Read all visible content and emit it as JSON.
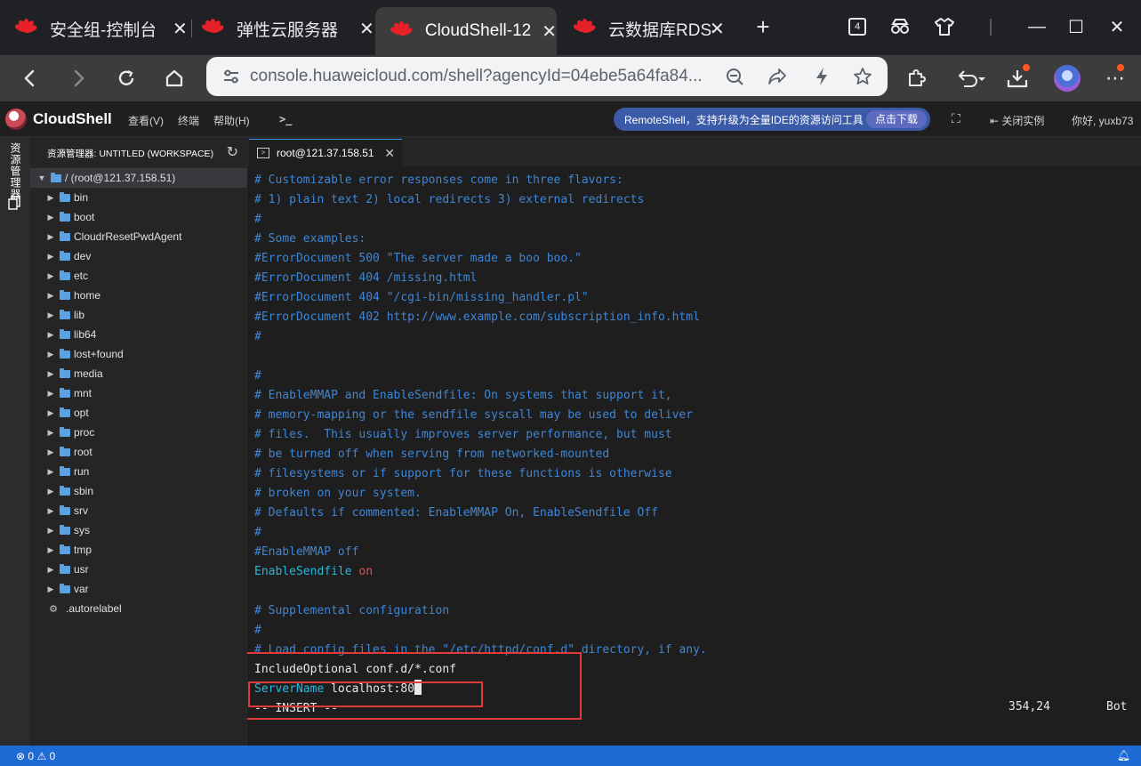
{
  "browser": {
    "tabs": [
      {
        "title": "安全组-控制台",
        "active": false
      },
      {
        "title": "弹性云服务器",
        "active": false
      },
      {
        "title": "CloudShell-12",
        "active": true
      },
      {
        "title": "云数据库RDS-",
        "active": false
      }
    ],
    "tab_count_badge": "4",
    "url": "console.huaweicloud.com/shell?agencyId=04ebe5a64fa84..."
  },
  "cloudshell": {
    "title": "CloudShell",
    "menu": [
      "查看(V)",
      "终端",
      "帮助(H)"
    ],
    "remote_banner": "RemoteShell，支持升级为全量IDE的资源访问工具",
    "download_label": "点击下载",
    "close_instance": "关闭实例",
    "greeting": "你好, yuxb73"
  },
  "activity_bar": {
    "label": "资源管理器"
  },
  "explorer": {
    "header": "资源管理器: UNTITLED (WORKSPACE)",
    "root": "/ (root@121.37.158.51)",
    "folders": [
      "bin",
      "boot",
      "CloudrResetPwdAgent",
      "dev",
      "etc",
      "home",
      "lib",
      "lib64",
      "lost+found",
      "media",
      "mnt",
      "opt",
      "proc",
      "root",
      "run",
      "sbin",
      "srv",
      "sys",
      "tmp",
      "usr",
      "var"
    ],
    "files": [
      ".autorelabel"
    ]
  },
  "editor": {
    "tab_label": "root@121.37.158.51"
  },
  "terminal": {
    "lines": [
      "# Customizable error responses come in three flavors:",
      "# 1) plain text 2) local redirects 3) external redirects",
      "#",
      "# Some examples:",
      "#ErrorDocument 500 \"The server made a boo boo.\"",
      "#ErrorDocument 404 /missing.html",
      "#ErrorDocument 404 \"/cgi-bin/missing_handler.pl\"",
      "#ErrorDocument 402 http://www.example.com/subscription_info.html",
      "#",
      "",
      "#",
      "# EnableMMAP and EnableSendfile: On systems that support it,",
      "# memory-mapping or the sendfile syscall may be used to deliver",
      "# files.  This usually improves server performance, but must",
      "# be turned off when serving from networked-mounted",
      "# filesystems or if support for these functions is otherwise",
      "# broken on your system.",
      "# Defaults if commented: EnableMMAP On, EnableSendfile Off",
      "#",
      "#EnableMMAP off"
    ],
    "send_kw": "EnableSendfile",
    "send_val": "on",
    "supp_lines": [
      "# Supplemental configuration",
      "#",
      "# Load config files in the \"/etc/httpd/conf.d\" directory, if any."
    ],
    "include_line": "IncludeOptional conf.d/*.conf",
    "server_kw": "ServerName",
    "server_val": "localhost:80",
    "mode_line": "-- INSERT --",
    "cursor_pos": "354,24",
    "scroll_pos": "Bot"
  },
  "statusbar": {
    "errors": "0",
    "warnings": "0"
  },
  "colors": {
    "comment": "#3e86d6",
    "keyword": "#29b8db",
    "value": "#e84d4d",
    "highlight_box": "#e03a3a",
    "statusbar": "#1f6bd6"
  }
}
